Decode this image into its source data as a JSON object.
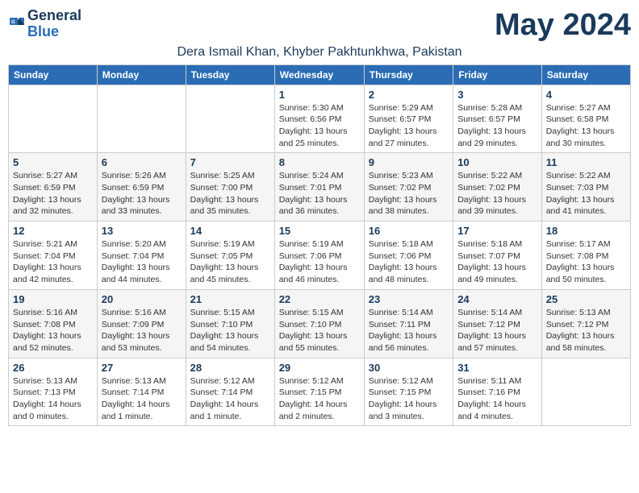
{
  "logo": {
    "line1": "General",
    "line2": "Blue"
  },
  "month": "May 2024",
  "location": "Dera Ismail Khan, Khyber Pakhtunkhwa, Pakistan",
  "headers": [
    "Sunday",
    "Monday",
    "Tuesday",
    "Wednesday",
    "Thursday",
    "Friday",
    "Saturday"
  ],
  "weeks": [
    [
      {
        "day": "",
        "info": ""
      },
      {
        "day": "",
        "info": ""
      },
      {
        "day": "",
        "info": ""
      },
      {
        "day": "1",
        "info": "Sunrise: 5:30 AM\nSunset: 6:56 PM\nDaylight: 13 hours\nand 25 minutes."
      },
      {
        "day": "2",
        "info": "Sunrise: 5:29 AM\nSunset: 6:57 PM\nDaylight: 13 hours\nand 27 minutes."
      },
      {
        "day": "3",
        "info": "Sunrise: 5:28 AM\nSunset: 6:57 PM\nDaylight: 13 hours\nand 29 minutes."
      },
      {
        "day": "4",
        "info": "Sunrise: 5:27 AM\nSunset: 6:58 PM\nDaylight: 13 hours\nand 30 minutes."
      }
    ],
    [
      {
        "day": "5",
        "info": "Sunrise: 5:27 AM\nSunset: 6:59 PM\nDaylight: 13 hours\nand 32 minutes."
      },
      {
        "day": "6",
        "info": "Sunrise: 5:26 AM\nSunset: 6:59 PM\nDaylight: 13 hours\nand 33 minutes."
      },
      {
        "day": "7",
        "info": "Sunrise: 5:25 AM\nSunset: 7:00 PM\nDaylight: 13 hours\nand 35 minutes."
      },
      {
        "day": "8",
        "info": "Sunrise: 5:24 AM\nSunset: 7:01 PM\nDaylight: 13 hours\nand 36 minutes."
      },
      {
        "day": "9",
        "info": "Sunrise: 5:23 AM\nSunset: 7:02 PM\nDaylight: 13 hours\nand 38 minutes."
      },
      {
        "day": "10",
        "info": "Sunrise: 5:22 AM\nSunset: 7:02 PM\nDaylight: 13 hours\nand 39 minutes."
      },
      {
        "day": "11",
        "info": "Sunrise: 5:22 AM\nSunset: 7:03 PM\nDaylight: 13 hours\nand 41 minutes."
      }
    ],
    [
      {
        "day": "12",
        "info": "Sunrise: 5:21 AM\nSunset: 7:04 PM\nDaylight: 13 hours\nand 42 minutes."
      },
      {
        "day": "13",
        "info": "Sunrise: 5:20 AM\nSunset: 7:04 PM\nDaylight: 13 hours\nand 44 minutes."
      },
      {
        "day": "14",
        "info": "Sunrise: 5:19 AM\nSunset: 7:05 PM\nDaylight: 13 hours\nand 45 minutes."
      },
      {
        "day": "15",
        "info": "Sunrise: 5:19 AM\nSunset: 7:06 PM\nDaylight: 13 hours\nand 46 minutes."
      },
      {
        "day": "16",
        "info": "Sunrise: 5:18 AM\nSunset: 7:06 PM\nDaylight: 13 hours\nand 48 minutes."
      },
      {
        "day": "17",
        "info": "Sunrise: 5:18 AM\nSunset: 7:07 PM\nDaylight: 13 hours\nand 49 minutes."
      },
      {
        "day": "18",
        "info": "Sunrise: 5:17 AM\nSunset: 7:08 PM\nDaylight: 13 hours\nand 50 minutes."
      }
    ],
    [
      {
        "day": "19",
        "info": "Sunrise: 5:16 AM\nSunset: 7:08 PM\nDaylight: 13 hours\nand 52 minutes."
      },
      {
        "day": "20",
        "info": "Sunrise: 5:16 AM\nSunset: 7:09 PM\nDaylight: 13 hours\nand 53 minutes."
      },
      {
        "day": "21",
        "info": "Sunrise: 5:15 AM\nSunset: 7:10 PM\nDaylight: 13 hours\nand 54 minutes."
      },
      {
        "day": "22",
        "info": "Sunrise: 5:15 AM\nSunset: 7:10 PM\nDaylight: 13 hours\nand 55 minutes."
      },
      {
        "day": "23",
        "info": "Sunrise: 5:14 AM\nSunset: 7:11 PM\nDaylight: 13 hours\nand 56 minutes."
      },
      {
        "day": "24",
        "info": "Sunrise: 5:14 AM\nSunset: 7:12 PM\nDaylight: 13 hours\nand 57 minutes."
      },
      {
        "day": "25",
        "info": "Sunrise: 5:13 AM\nSunset: 7:12 PM\nDaylight: 13 hours\nand 58 minutes."
      }
    ],
    [
      {
        "day": "26",
        "info": "Sunrise: 5:13 AM\nSunset: 7:13 PM\nDaylight: 14 hours\nand 0 minutes."
      },
      {
        "day": "27",
        "info": "Sunrise: 5:13 AM\nSunset: 7:14 PM\nDaylight: 14 hours\nand 1 minute."
      },
      {
        "day": "28",
        "info": "Sunrise: 5:12 AM\nSunset: 7:14 PM\nDaylight: 14 hours\nand 1 minute."
      },
      {
        "day": "29",
        "info": "Sunrise: 5:12 AM\nSunset: 7:15 PM\nDaylight: 14 hours\nand 2 minutes."
      },
      {
        "day": "30",
        "info": "Sunrise: 5:12 AM\nSunset: 7:15 PM\nDaylight: 14 hours\nand 3 minutes."
      },
      {
        "day": "31",
        "info": "Sunrise: 5:11 AM\nSunset: 7:16 PM\nDaylight: 14 hours\nand 4 minutes."
      },
      {
        "day": "",
        "info": ""
      }
    ]
  ]
}
